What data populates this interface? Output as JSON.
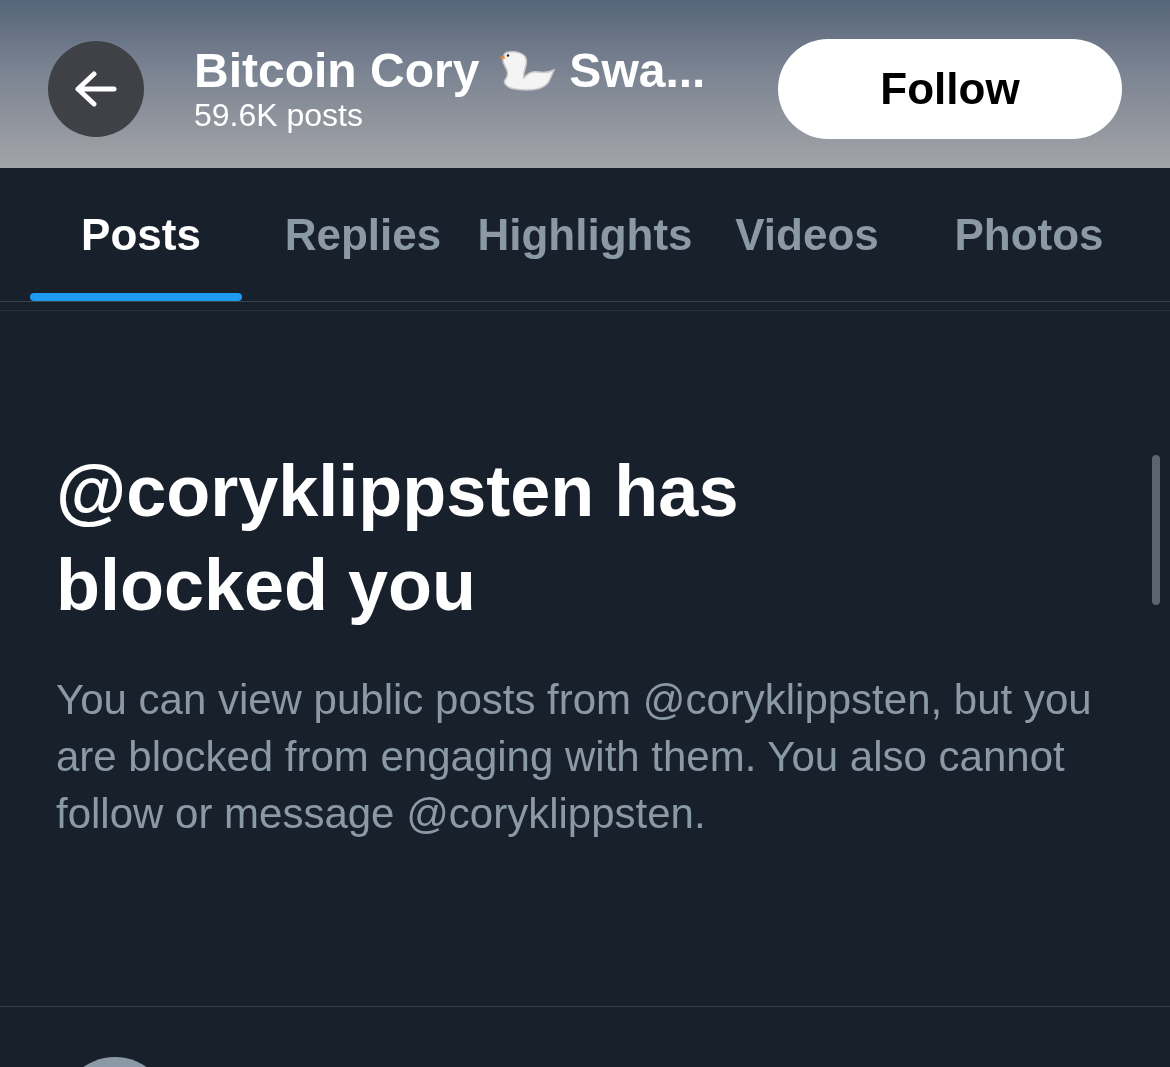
{
  "header": {
    "title": "Bitcoin Cory",
    "title_suffix": "Swa...",
    "subtitle": "59.6K posts",
    "follow_button": "Follow"
  },
  "tabs": [
    {
      "label": "Posts",
      "selected": true
    },
    {
      "label": "Replies",
      "selected": false
    },
    {
      "label": "Highlights",
      "selected": false
    },
    {
      "label": "Videos",
      "selected": false
    },
    {
      "label": "Photos",
      "selected": false
    }
  ],
  "notice": {
    "title": "@coryklippsten has blocked you",
    "body": "You can view public posts from @coryklippsten, but you are blocked from engaging with them. You also cannot follow or message @coryklippsten."
  }
}
